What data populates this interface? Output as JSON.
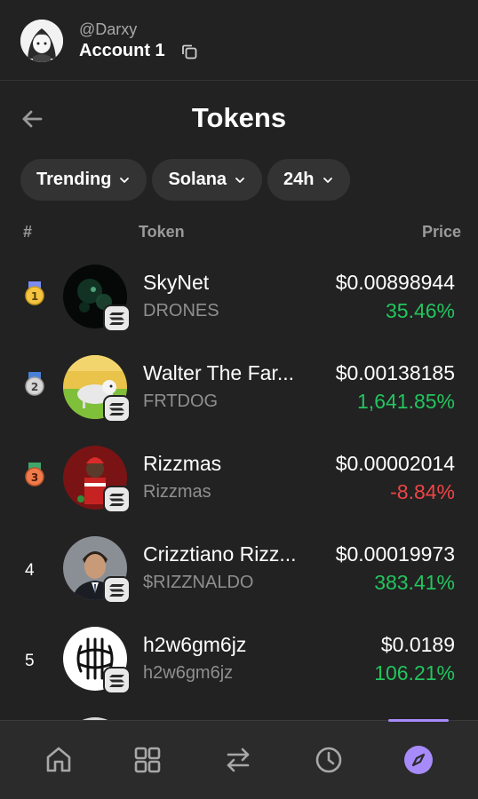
{
  "header": {
    "handle": "@Darxy",
    "account": "Account 1"
  },
  "page": {
    "title": "Tokens"
  },
  "filters": [
    {
      "label": "Trending"
    },
    {
      "label": "Solana"
    },
    {
      "label": "24h"
    }
  ],
  "columns": {
    "rank": "#",
    "token": "Token",
    "price": "Price"
  },
  "tokens": [
    {
      "rank": "1",
      "name": "SkyNet",
      "symbol": "DRONES",
      "price": "$0.00898944",
      "change": "35.46%",
      "direction": "up",
      "medal_color": "#f5c542"
    },
    {
      "rank": "2",
      "name": "Walter The Far...",
      "symbol": "FRTDOG",
      "price": "$0.00138185",
      "change": "1,641.85%",
      "direction": "up",
      "medal_color": "#d6d6d6"
    },
    {
      "rank": "3",
      "name": "Rizzmas",
      "symbol": "Rizzmas",
      "price": "$0.00002014",
      "change": "-8.84%",
      "direction": "down",
      "medal_color": "#f07a4a"
    },
    {
      "rank": "4",
      "name": "Crizztiano Rizz...",
      "symbol": "$RIZZNALDO",
      "price": "$0.00019973",
      "change": "383.41%",
      "direction": "up"
    },
    {
      "rank": "5",
      "name": "h2w6gm6jz",
      "symbol": "h2w6gm6jz",
      "price": "$0.0189",
      "change": "106.21%",
      "direction": "up"
    }
  ],
  "nav": [
    {
      "icon": "home-icon"
    },
    {
      "icon": "grid-icon"
    },
    {
      "icon": "swap-icon"
    },
    {
      "icon": "history-icon"
    },
    {
      "icon": "compass-icon",
      "active": true
    }
  ],
  "colors": {
    "accent": "#a78bfa",
    "positive": "#22c55e",
    "negative": "#ef4444"
  }
}
